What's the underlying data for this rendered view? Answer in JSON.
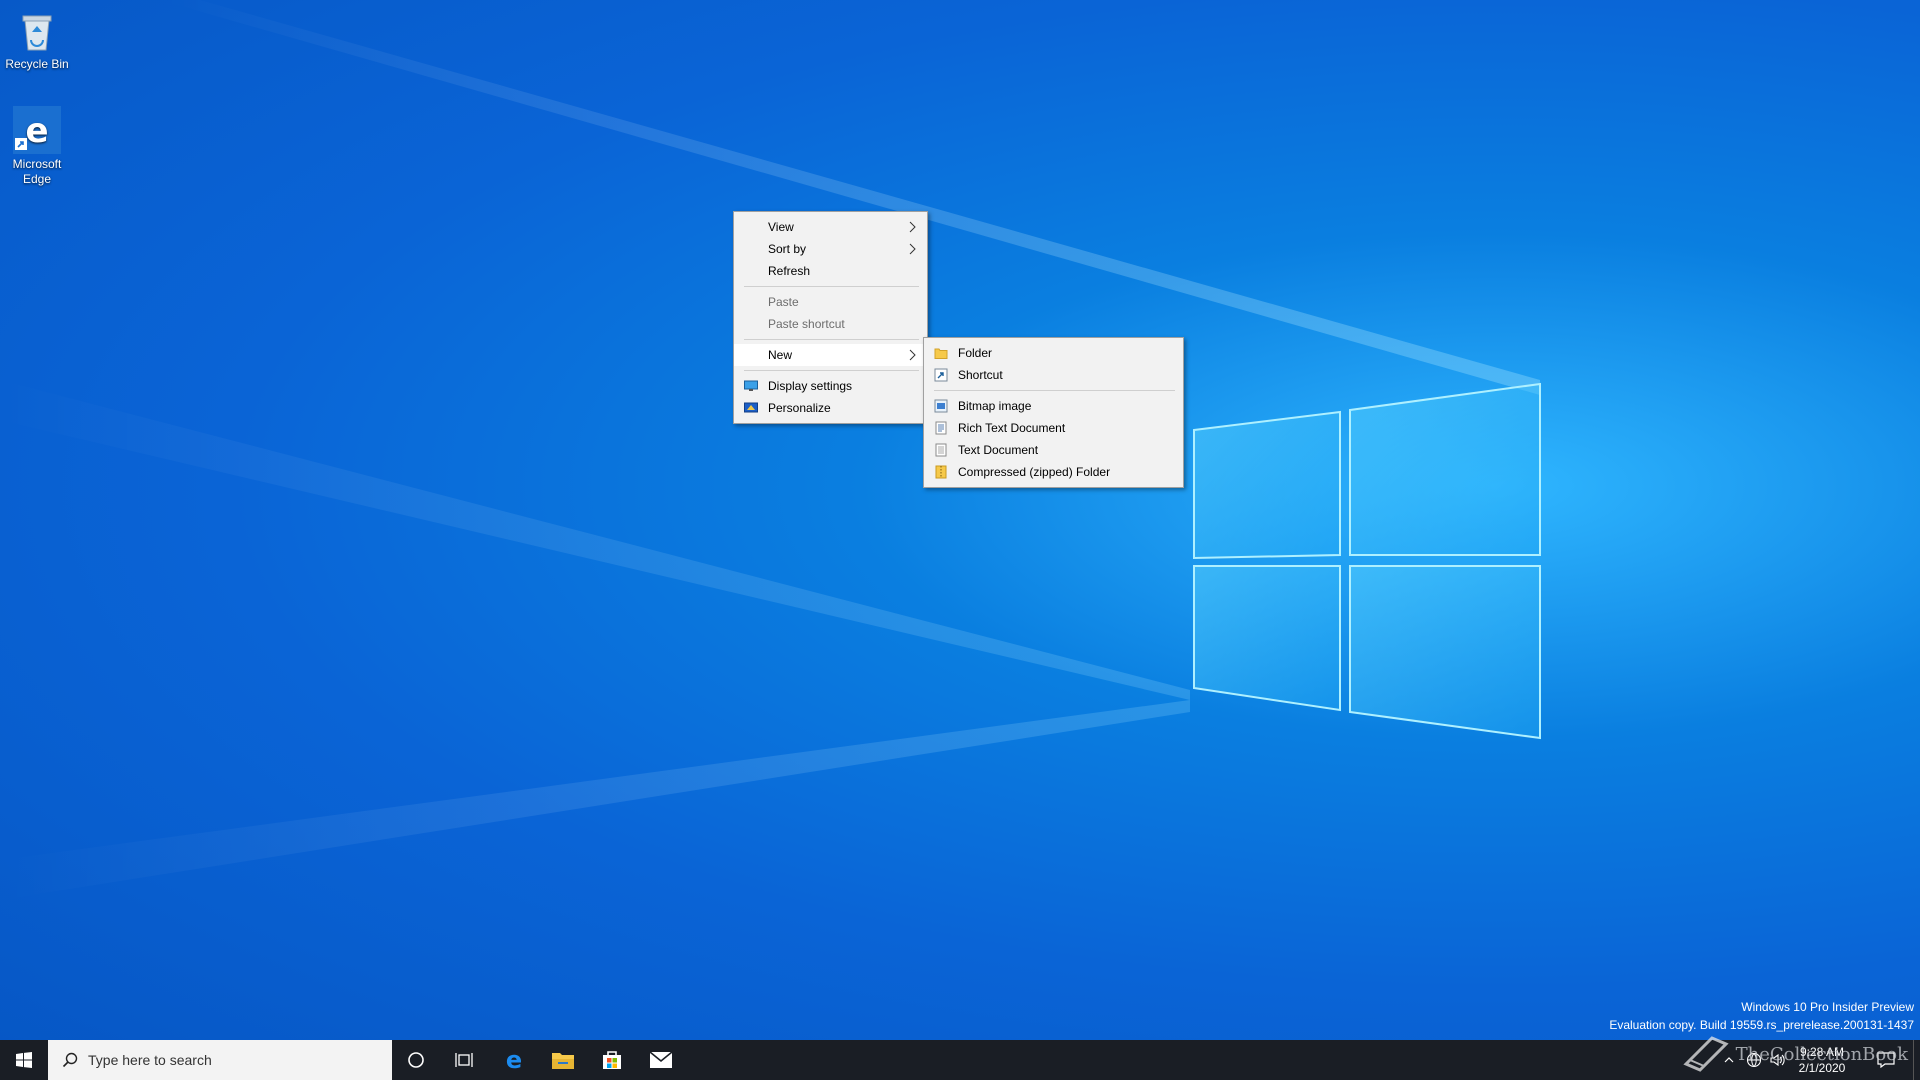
{
  "desktop": {
    "icons": [
      {
        "label": "Recycle Bin",
        "icon": "recycle-bin-icon"
      },
      {
        "label": "Microsoft Edge",
        "icon": "edge-icon"
      }
    ]
  },
  "context_menu": {
    "items": [
      {
        "label": "View",
        "submenu": true
      },
      {
        "label": "Sort by",
        "submenu": true
      },
      {
        "label": "Refresh"
      },
      {
        "label": "Paste",
        "disabled": true
      },
      {
        "label": "Paste shortcut",
        "disabled": true
      },
      {
        "label": "New",
        "submenu": true,
        "active": true
      },
      {
        "label": "Display settings",
        "icon": "display-settings-icon"
      },
      {
        "label": "Personalize",
        "icon": "personalize-icon"
      }
    ]
  },
  "new_submenu": {
    "items": [
      {
        "label": "Folder",
        "icon": "folder-icon"
      },
      {
        "label": "Shortcut",
        "icon": "shortcut-icon"
      },
      {
        "label": "Bitmap image",
        "icon": "bitmap-image-icon"
      },
      {
        "label": "Rich Text Document",
        "icon": "rich-text-document-icon"
      },
      {
        "label": "Text Document",
        "icon": "text-document-icon"
      },
      {
        "label": "Compressed (zipped) Folder",
        "icon": "zip-folder-icon"
      }
    ]
  },
  "taskbar": {
    "search_placeholder": "Type here to search",
    "pinned": [
      "edge-icon",
      "file-explorer-icon",
      "store-icon",
      "mail-icon"
    ],
    "clock_time": "9:28 AM",
    "clock_date": "2/1/2020"
  },
  "watermark": {
    "line1": "Windows 10 Pro Insider Preview",
    "line2": "Evaluation copy. Build 19559.rs_prerelease.200131-1437"
  },
  "overlay_logo": {
    "text": "TheCollectionBook"
  },
  "colors": {
    "desktop_accent": "#0a7fe0",
    "taskbar_bg": "#1a1e25",
    "menu_bg": "#f2f2f2"
  }
}
